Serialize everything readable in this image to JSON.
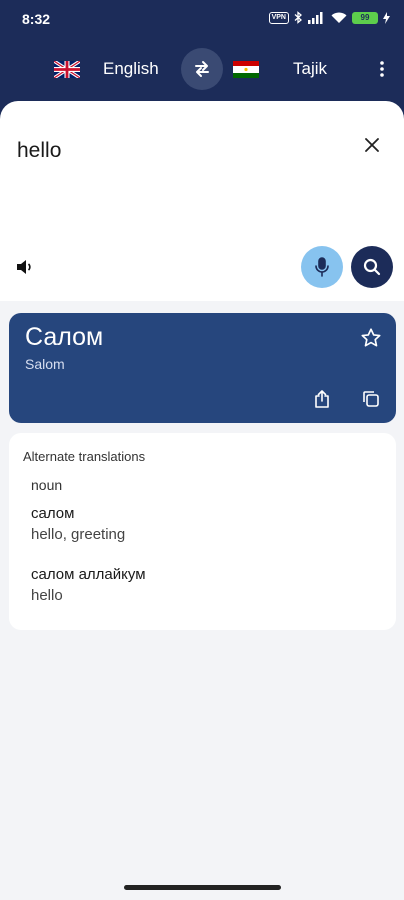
{
  "status_bar": {
    "time": "8:32",
    "vpn_label": "VPN",
    "battery_level": "99"
  },
  "language_bar": {
    "source_language": "English",
    "target_language": "Tajik",
    "source_flag_icon": "uk-flag-icon",
    "target_flag_icon": "tajikistan-flag-icon"
  },
  "input": {
    "text": "hello"
  },
  "result": {
    "translation": "Салом",
    "transliteration": "Salom"
  },
  "alternates": {
    "title": "Alternate translations",
    "part_of_speech": "noun",
    "items": [
      {
        "word": "салом",
        "meaning": "hello, greeting"
      },
      {
        "word": "салом аллайкум",
        "meaning": "hello"
      }
    ]
  },
  "colors": {
    "header": "#1c2c59",
    "result_card": "#26467d",
    "mic_button": "#87c3ef",
    "background": "#f3f4f7"
  }
}
